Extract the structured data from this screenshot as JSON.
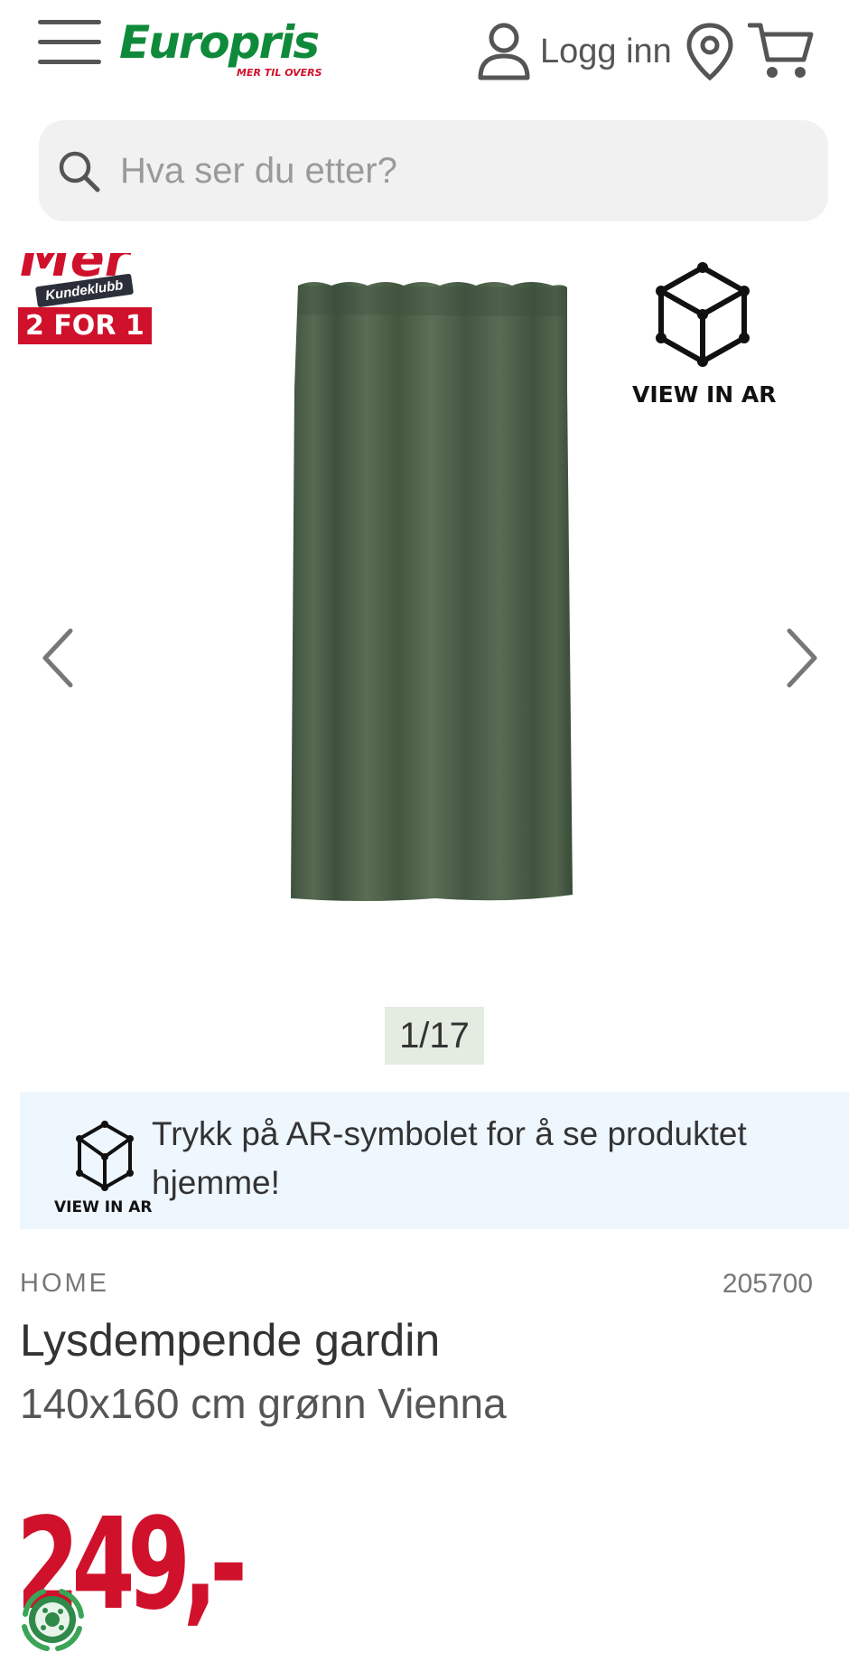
{
  "header": {
    "logo_text": "Europris",
    "logo_tagline": "MER TIL OVERS",
    "login_label": "Logg inn",
    "icons": [
      "menu-icon",
      "user-icon",
      "location-pin-icon",
      "cart-icon"
    ]
  },
  "search": {
    "placeholder": "Hva ser du etter?",
    "value": ""
  },
  "gallery": {
    "badge_club_mer": "Mer",
    "badge_club_label": "Kundeklubb",
    "badge_offer": "2 FOR 1",
    "ar_label": "VIEW IN AR",
    "counter": "1/17",
    "current_image": 1,
    "total_images": 17
  },
  "ar_info": {
    "label": "VIEW IN AR",
    "text": "Trykk på AR-symbolet for å se produktet hjemme!"
  },
  "product": {
    "brand": "HOME",
    "sku": "205700",
    "title": "Lysdempende gardin",
    "subtitle": "140x160 cm grønn Vienna",
    "price": "249,-"
  },
  "colors": {
    "brand_green": "#0f8a3a",
    "brand_red": "#d0112b",
    "curtain_green": "#4b5f48",
    "ar_info_bg": "#eef6fe"
  }
}
